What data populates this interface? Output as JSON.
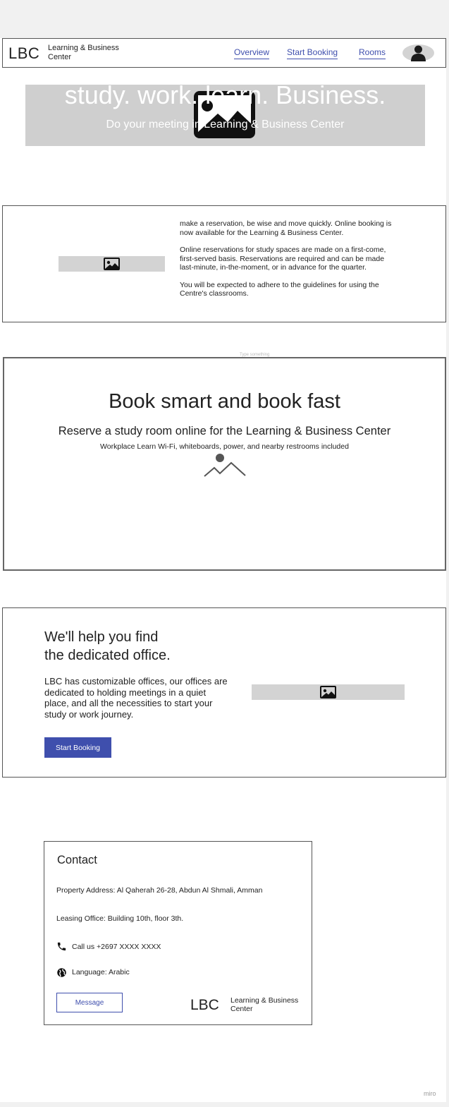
{
  "header": {
    "logo": "LBC",
    "logo_sub": "Learning & Business Center",
    "nav": [
      "Overview",
      "Start Booking",
      "Rooms"
    ]
  },
  "hero": {
    "title": "study. work. learn. Business.",
    "subtitle": "Do your meeting in Learning & Business Center"
  },
  "info": {
    "paragraphs": [
      "make a reservation, be wise and move quickly. Online booking is now available for the Learning & Business Center.",
      "Online reservations for study spaces are made on a first-come, first-served basis. Reservations are required and can be made last-minute, in-the-moment, or in advance for the quarter.",
      "You will be expected to adhere to the guidelines for using the Centre's classrooms."
    ]
  },
  "tiny_label": "Type something",
  "book": {
    "title": "Book smart and book fast",
    "subtitle": "Reserve a study room online for the Learning & Business Center",
    "small": "Workplace Learn Wi-Fi, whiteboards, power, and nearby restrooms included"
  },
  "office": {
    "title_line1": "We'll help you find",
    "title_line2": "the dedicated office.",
    "text": "LBC has customizable offices, our offices are dedicated to holding meetings in a quiet place, and all the necessities to start your study or work journey.",
    "button": "Start Booking"
  },
  "contact": {
    "title": "Contact",
    "address": "Property Address: Al Qaherah 26-28, Abdun Al Shmali, Amman",
    "leasing": "Leasing Office: Building 10th, floor 3th.",
    "phone": "Call us +2697 XXXX XXXX",
    "language": "Language: Arabic",
    "message_button": "Message",
    "logo": "LBC",
    "logo_sub": "Learning & Business Center"
  },
  "watermark": "miro",
  "colors": {
    "accent": "#3f4fad",
    "placeholder": "#d3d3d3"
  }
}
